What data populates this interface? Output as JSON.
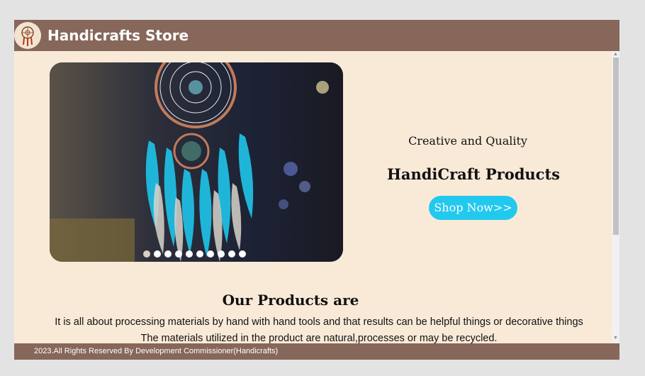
{
  "header": {
    "logo_icon": "dreamcatcher-logo-icon",
    "brand": "Handicrafts Store"
  },
  "hero": {
    "image_icon": "dreamcatcher-photo",
    "tagline": "Creative and Quality",
    "headline": "HandiCraft Products",
    "cta_label": "Shop Now>>",
    "carousel": {
      "slide_count": 10,
      "active_index": 0
    }
  },
  "products": {
    "title": "Our Products are",
    "line1": "It is all about processing materials by hand with hand tools and that results can be helpful things or decorative things",
    "line2": "The materials utilized in the product are natural,processes or may be recycled."
  },
  "footer": {
    "text": "2023.All Rights Reserved By Development Commissioner(Handicrafts)"
  },
  "colors": {
    "header_bg": "#86675a",
    "page_bg": "#f9ead8",
    "cta_bg": "#21c9ee"
  }
}
